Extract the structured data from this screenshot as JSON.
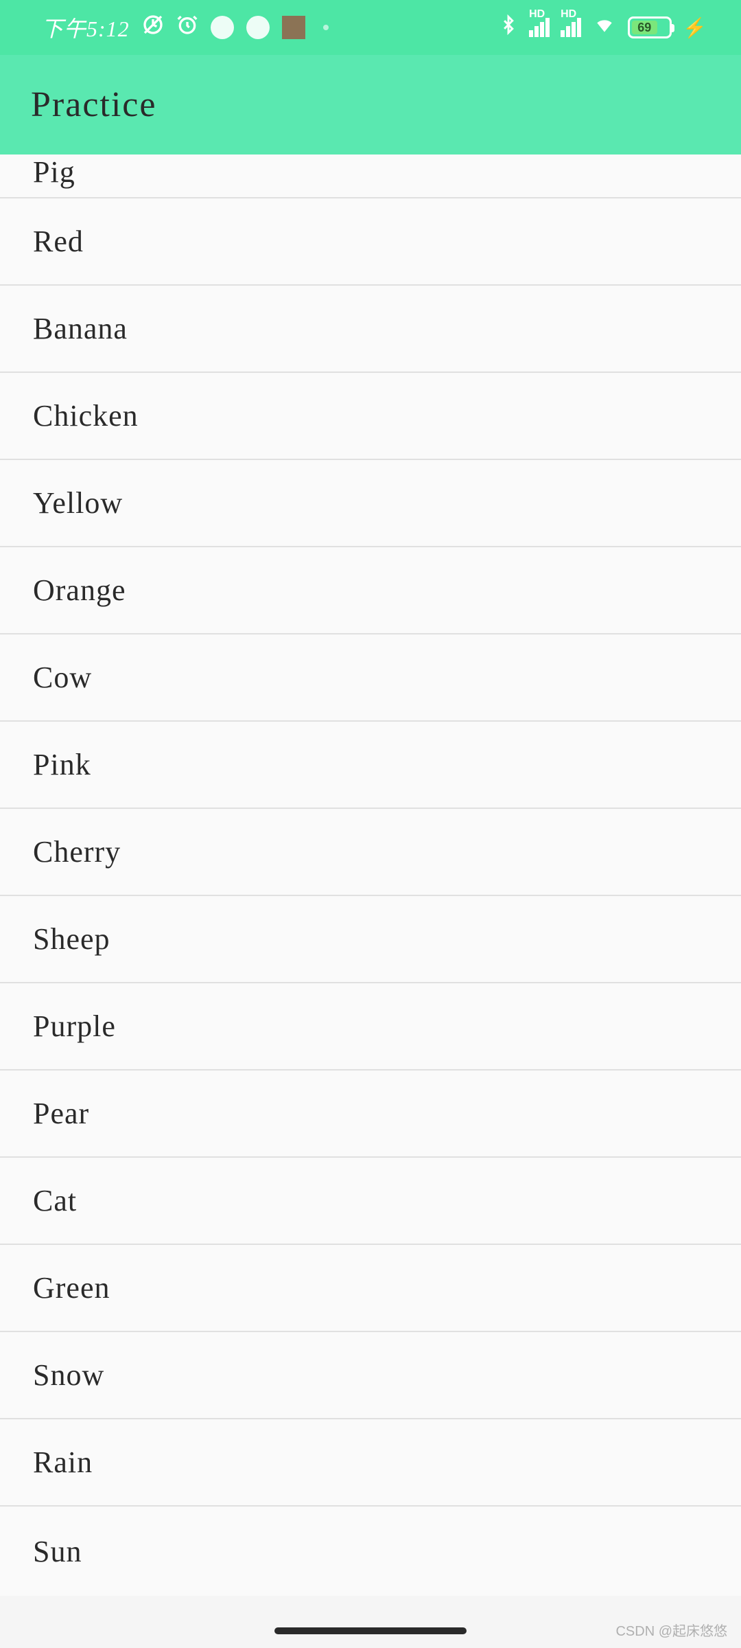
{
  "status_bar": {
    "time": "下午5:12",
    "battery_level": "69",
    "hd1": "HD",
    "hd2": "HD"
  },
  "app_bar": {
    "title": "Practice"
  },
  "list": {
    "items": [
      "Pig",
      "Red",
      "Banana",
      "Chicken",
      "Yellow",
      "Orange",
      "Cow",
      "Pink",
      "Cherry",
      "Sheep",
      "Purple",
      "Pear",
      "Cat",
      "Green",
      "Snow",
      "Rain",
      "Sun"
    ]
  },
  "watermark": "CSDN @起床悠悠"
}
